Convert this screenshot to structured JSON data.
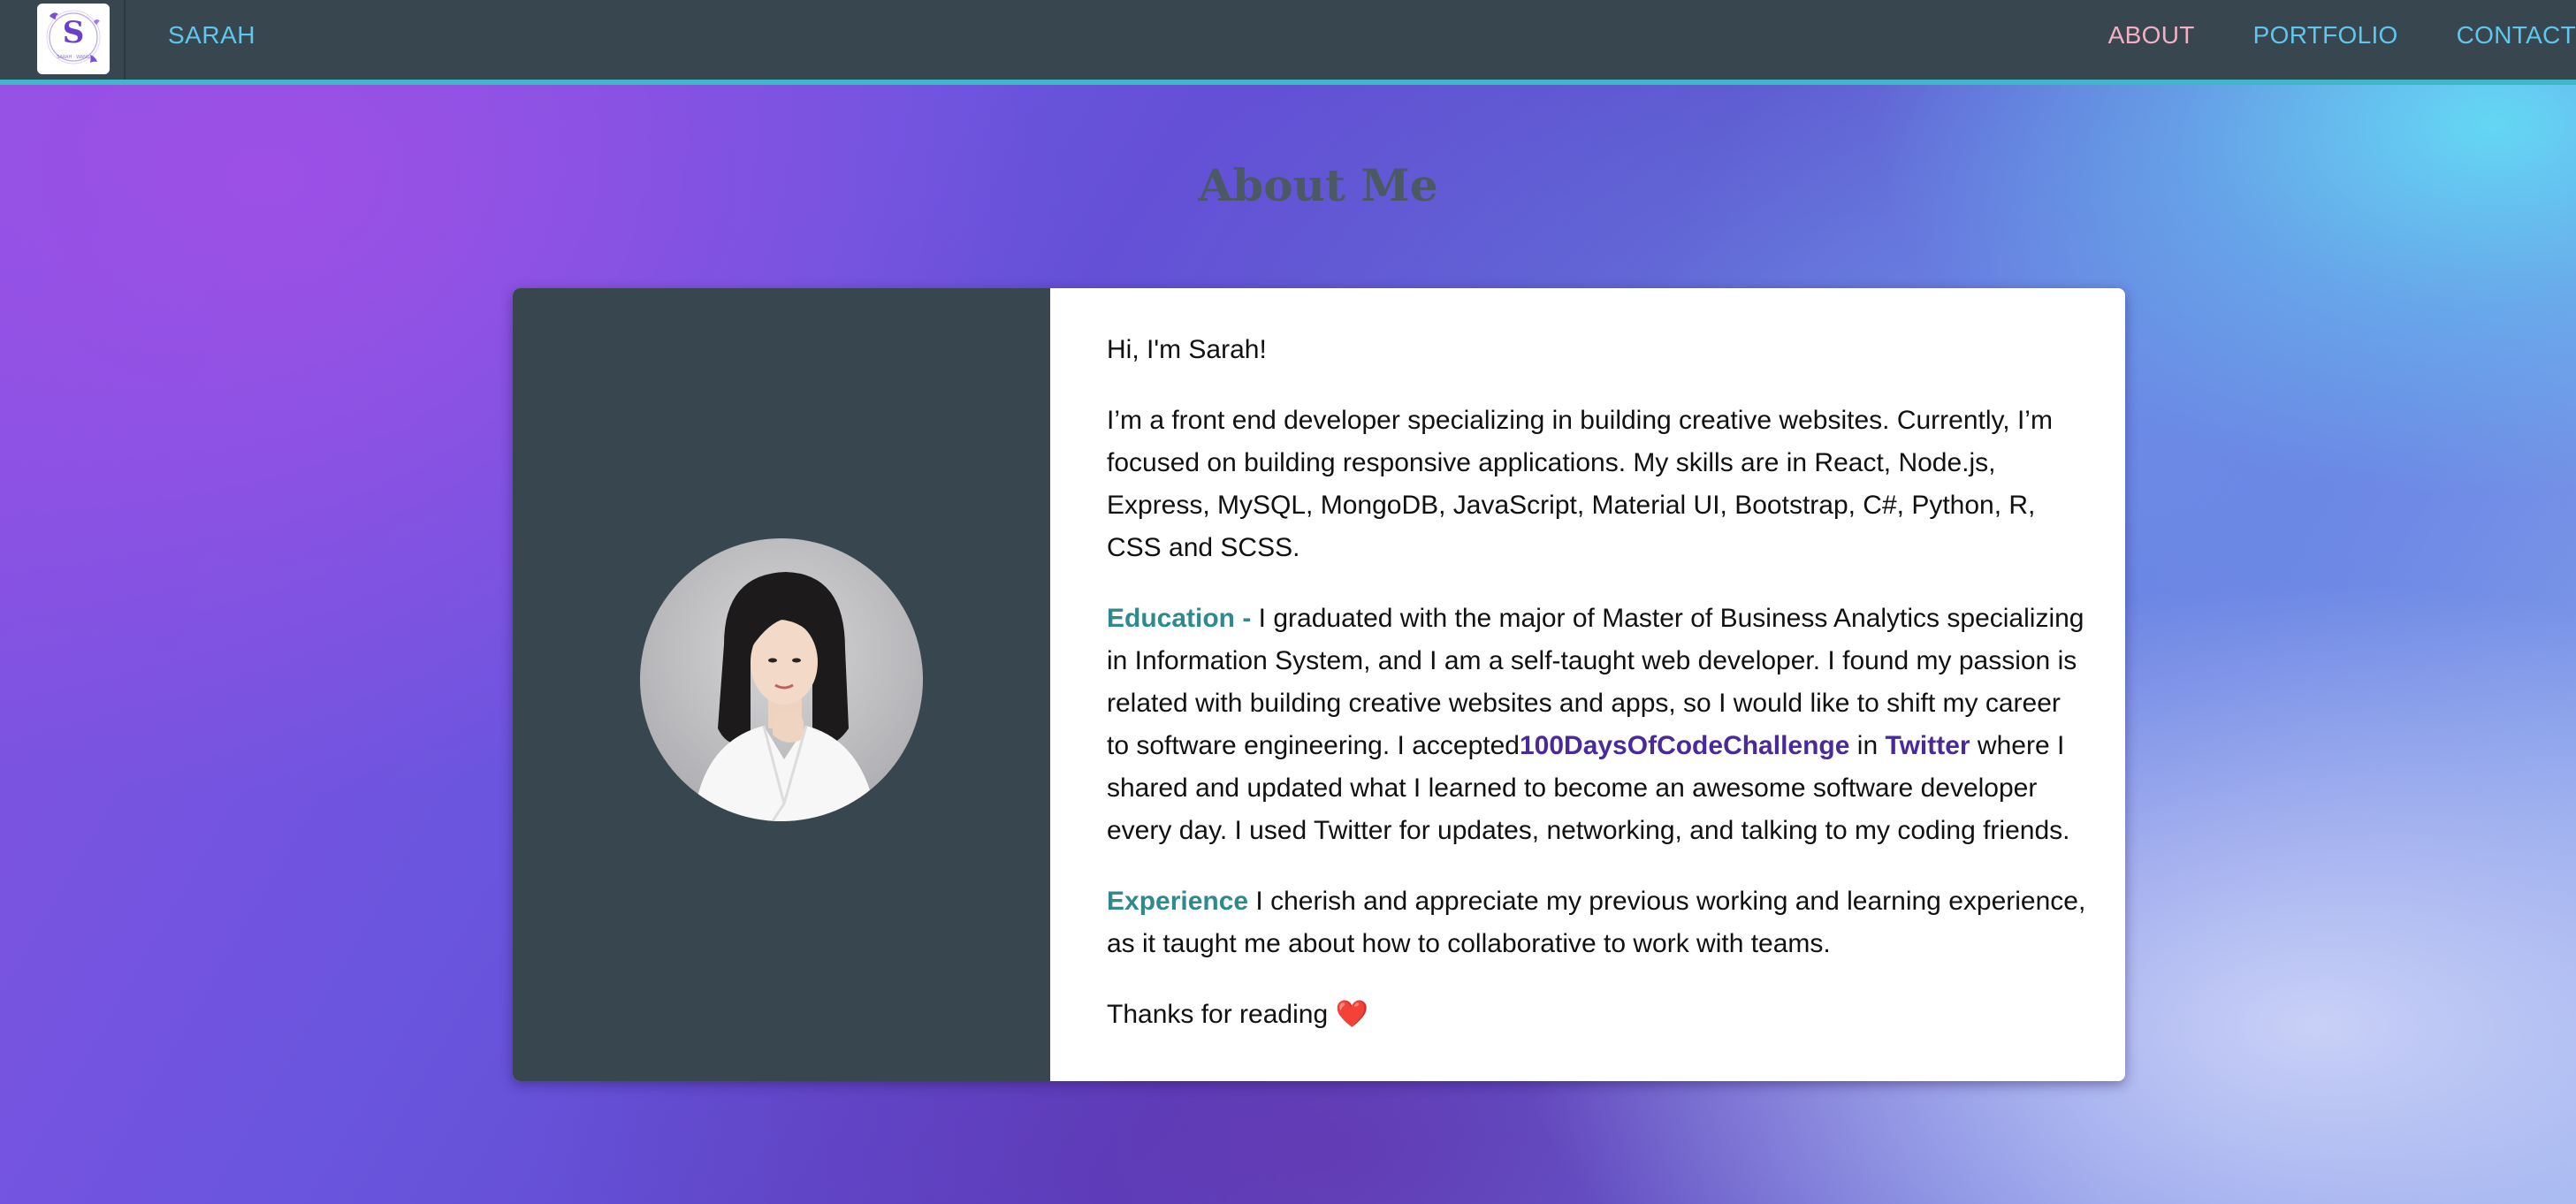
{
  "navbar": {
    "logo_letter": "S",
    "logo_caption": "SARAH · WANG",
    "brand": "SARAH",
    "links": [
      {
        "label": "ABOUT",
        "active": true
      },
      {
        "label": "PORTFOLIO",
        "active": false
      },
      {
        "label": "CONTACT",
        "active": false
      }
    ]
  },
  "page": {
    "title": "About Me"
  },
  "about": {
    "greeting": "Hi, I'm Sarah!",
    "intro": "I’m a front end developer specializing in building creative websites. Currently, I’m focused on building responsive applications. My skills are in React, Node.js, Express, MySQL, MongoDB, JavaScript, Material UI, Bootstrap, C#, Python, R, CSS and SCSS.",
    "education": {
      "label": "Education -",
      "text_1": " I graduated with the major of Master of Business Analytics specializing in Information System, and I am a self-taught web developer. I found my passion is related with building creative websites and apps, so I would like to shift my career to software engineering. I accepted",
      "challenge": "100DaysOfCodeChallenge",
      "text_2": " in ",
      "twitter": "Twitter",
      "text_3": " where I shared and updated what I learned to become an awesome software developer every day. I used Twitter for updates, networking, and talking to my coding friends."
    },
    "experience": {
      "label": "Experience",
      "text": " I cherish and appreciate my previous working and learning experience, as it taught me about how to collaborative to work with teams."
    },
    "closing": "Thanks for reading ",
    "closing_emoji": "❤️"
  },
  "colors": {
    "navbar_bg": "#38474f",
    "accent_cyan": "#5fc6ee",
    "active_link": "#f2b0c4",
    "highlight_teal": "#2e8a8f",
    "highlight_purple": "#4a2a9a",
    "card_left_bg": "#38474f"
  }
}
